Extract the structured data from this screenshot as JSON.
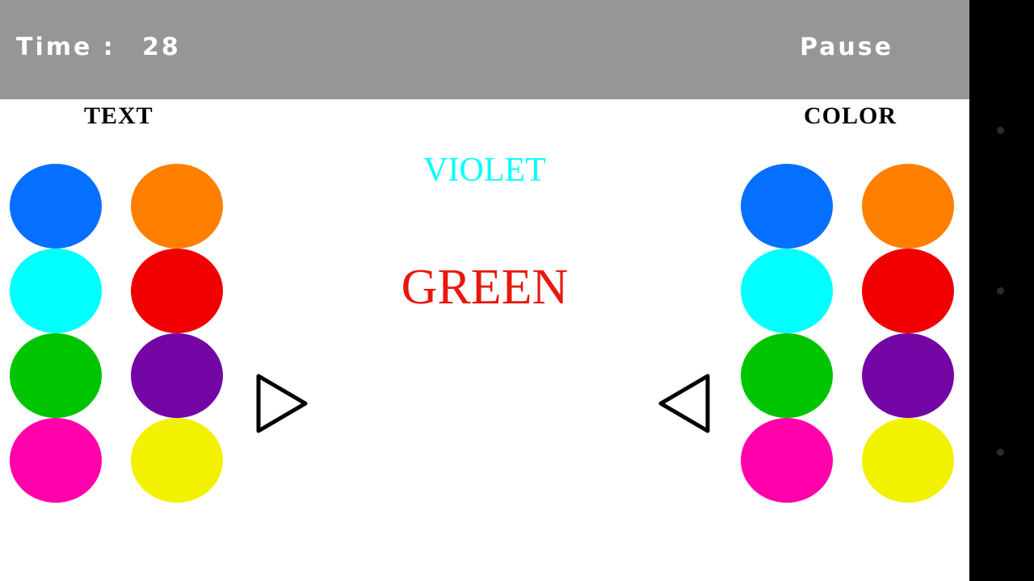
{
  "hud": {
    "time_label": "Time :",
    "time_value": "28",
    "pause_label": "Pause",
    "background_color": "#969696",
    "text_color": "#ffffff"
  },
  "columns": {
    "left_caption": "TEXT",
    "right_caption": "COLOR"
  },
  "stimuli": [
    {
      "word": "VIOLET",
      "ink_color": "#00FFFF"
    },
    {
      "word": "GREEN",
      "ink_color": "#E8180C"
    }
  ],
  "palette": [
    {
      "name": "blue",
      "hex": "#0570FF"
    },
    {
      "name": "orange",
      "hex": "#FF7F00"
    },
    {
      "name": "cyan",
      "hex": "#00FFFF"
    },
    {
      "name": "red",
      "hex": "#F00000"
    },
    {
      "name": "green",
      "hex": "#00C400"
    },
    {
      "name": "violet",
      "hex": "#7406A6"
    },
    {
      "name": "magenta",
      "hex": "#FF00AA"
    },
    {
      "name": "yellow",
      "hex": "#F2F200"
    }
  ],
  "controls": {
    "right_arrow_name": "triangle-right-icon",
    "left_arrow_name": "triangle-left-icon",
    "arrow_stroke_color": "#000000"
  },
  "system_nav": {
    "background_color": "#000000",
    "dot_color": "#2b2b2b",
    "dot_count": 3
  }
}
